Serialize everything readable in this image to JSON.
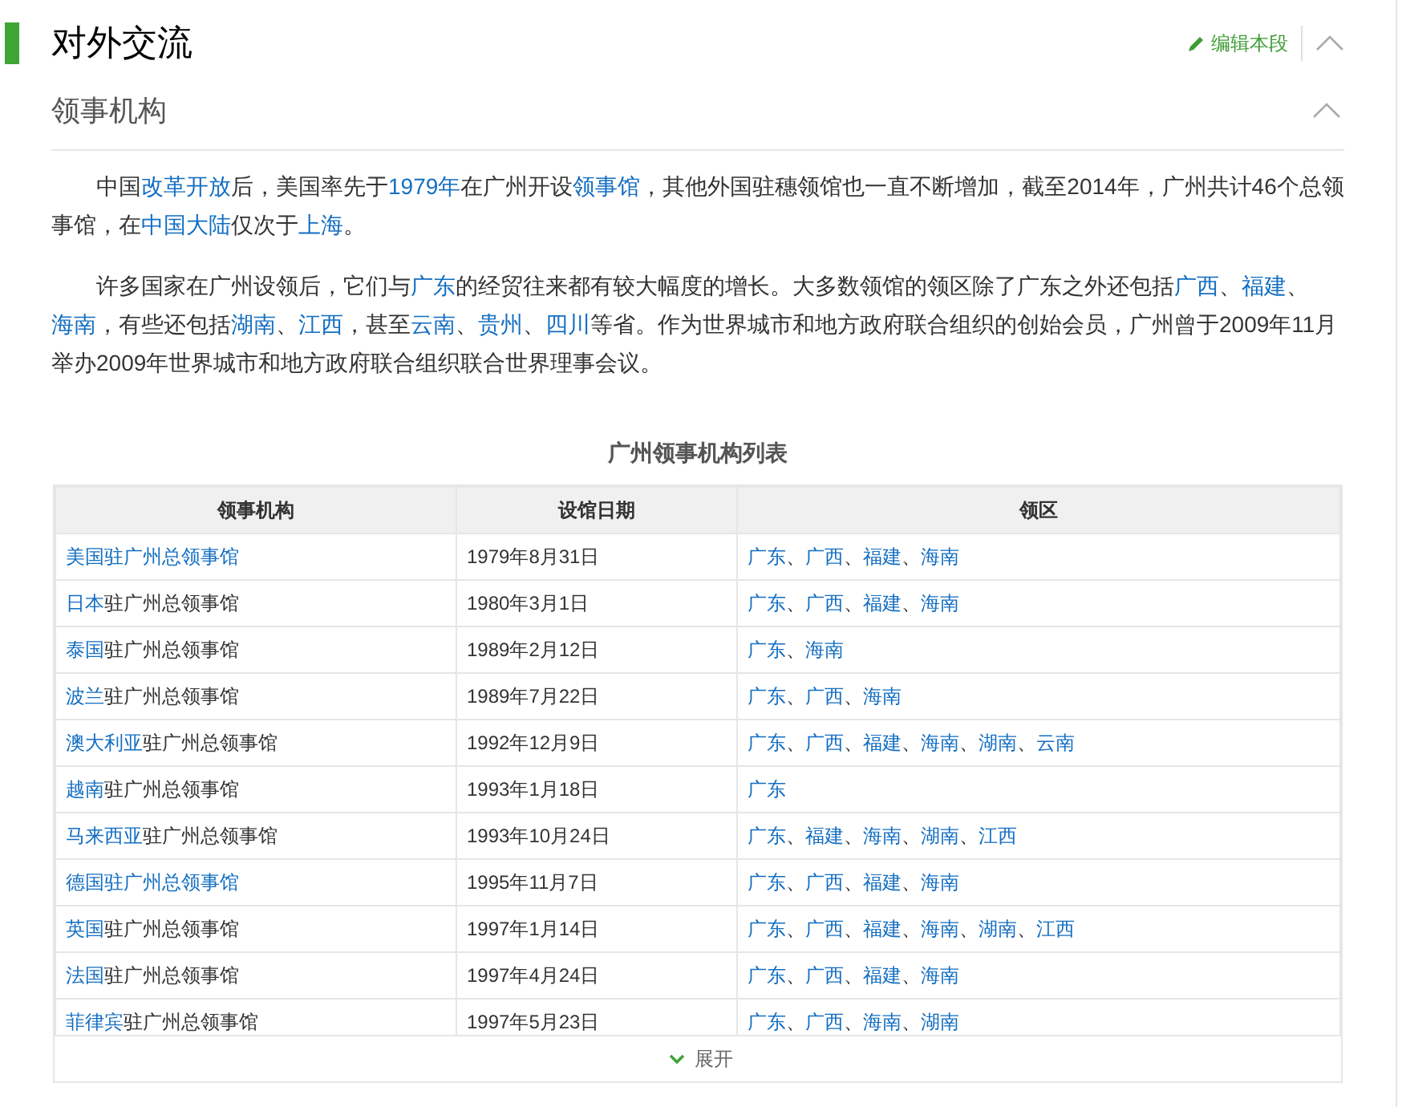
{
  "section": {
    "title": "对外交流",
    "edit_label": "编辑本段"
  },
  "subsection": {
    "title": "领事机构"
  },
  "paragraphs": [
    [
      {
        "text": "中国",
        "kind": "text"
      },
      {
        "text": "改革开放",
        "kind": "link"
      },
      {
        "text": "后，美国率先于",
        "kind": "text"
      },
      {
        "text": "1979年",
        "kind": "link"
      },
      {
        "text": "在广州开设",
        "kind": "text"
      },
      {
        "text": "领事馆",
        "kind": "link"
      },
      {
        "text": "，其他外国驻穗领馆也一直不断增加，截至2014年，广州共计46个总领事馆，在",
        "kind": "text"
      },
      {
        "text": "中国大陆",
        "kind": "link"
      },
      {
        "text": "仅次于",
        "kind": "text"
      },
      {
        "text": "上海",
        "kind": "link"
      },
      {
        "text": "。",
        "kind": "text"
      }
    ],
    [
      {
        "text": "许多国家在广州设领后，它们与",
        "kind": "text"
      },
      {
        "text": "广东",
        "kind": "link"
      },
      {
        "text": "的经贸往来都有较大幅度的增长。大多数领馆的领区除了广东之外还包括",
        "kind": "text"
      },
      {
        "text": "广西",
        "kind": "link"
      },
      {
        "text": "、",
        "kind": "text"
      },
      {
        "text": "福建",
        "kind": "link"
      },
      {
        "text": "、",
        "kind": "text"
      },
      {
        "text": "海南",
        "kind": "link"
      },
      {
        "text": "，有些还包括",
        "kind": "text"
      },
      {
        "text": "湖南",
        "kind": "link"
      },
      {
        "text": "、",
        "kind": "text"
      },
      {
        "text": "江西",
        "kind": "link"
      },
      {
        "text": "，甚至",
        "kind": "text"
      },
      {
        "text": "云南",
        "kind": "link"
      },
      {
        "text": "、",
        "kind": "text"
      },
      {
        "text": "贵州",
        "kind": "link"
      },
      {
        "text": "、",
        "kind": "text"
      },
      {
        "text": "四川",
        "kind": "link"
      },
      {
        "text": "等省。作为世界城市和地方政府联合组织的创始会员，广州曾于2009年11月举办2009年世界城市和地方政府联合组织联合世界理事会议。",
        "kind": "text"
      }
    ]
  ],
  "table": {
    "caption": "广州领事机构列表",
    "columns": [
      "领事机构",
      "设馆日期",
      "领区"
    ],
    "separator": "、",
    "rows": [
      {
        "name": [
          {
            "text": "美国驻广州总领事馆",
            "kind": "link"
          }
        ],
        "date": "1979年8月31日",
        "regions": [
          "广东",
          "广西",
          "福建",
          "海南"
        ]
      },
      {
        "name": [
          {
            "text": "日本",
            "kind": "link"
          },
          {
            "text": "驻广州总领事馆",
            "kind": "text"
          }
        ],
        "date": "1980年3月1日",
        "regions": [
          "广东",
          "广西",
          "福建",
          "海南"
        ]
      },
      {
        "name": [
          {
            "text": "泰国",
            "kind": "link"
          },
          {
            "text": "驻广州总领事馆",
            "kind": "text"
          }
        ],
        "date": "1989年2月12日",
        "regions": [
          "广东",
          "海南"
        ]
      },
      {
        "name": [
          {
            "text": "波兰",
            "kind": "link"
          },
          {
            "text": "驻广州总领事馆",
            "kind": "text"
          }
        ],
        "date": "1989年7月22日",
        "regions": [
          "广东",
          "广西",
          "海南"
        ]
      },
      {
        "name": [
          {
            "text": "澳大利亚",
            "kind": "link"
          },
          {
            "text": "驻广州总领事馆",
            "kind": "text"
          }
        ],
        "date": "1992年12月9日",
        "regions": [
          "广东",
          "广西",
          "福建",
          "海南",
          "湖南",
          "云南"
        ]
      },
      {
        "name": [
          {
            "text": "越南",
            "kind": "link"
          },
          {
            "text": "驻广州总领事馆",
            "kind": "text"
          }
        ],
        "date": "1993年1月18日",
        "regions": [
          "广东"
        ]
      },
      {
        "name": [
          {
            "text": "马来西亚",
            "kind": "link"
          },
          {
            "text": "驻广州总领事馆",
            "kind": "text"
          }
        ],
        "date": "1993年10月24日",
        "regions": [
          "广东",
          "福建",
          "海南",
          "湖南",
          "江西"
        ]
      },
      {
        "name": [
          {
            "text": "德国驻广州总领事馆",
            "kind": "link"
          }
        ],
        "date": "1995年11月7日",
        "regions": [
          "广东",
          "广西",
          "福建",
          "海南"
        ]
      },
      {
        "name": [
          {
            "text": "英国",
            "kind": "link"
          },
          {
            "text": "驻广州总领事馆",
            "kind": "text"
          }
        ],
        "date": "1997年1月14日",
        "regions": [
          "广东",
          "广西",
          "福建",
          "海南",
          "湖南",
          "江西"
        ]
      },
      {
        "name": [
          {
            "text": "法国",
            "kind": "link"
          },
          {
            "text": "驻广州总领事馆",
            "kind": "text"
          }
        ],
        "date": "1997年4月24日",
        "regions": [
          "广东",
          "广西",
          "福建",
          "海南"
        ]
      },
      {
        "name": [
          {
            "text": "菲律宾",
            "kind": "link"
          },
          {
            "text": "驻广州总领事馆",
            "kind": "text"
          }
        ],
        "date": "1997年5月23日",
        "regions": [
          "广东",
          "广西",
          "海南",
          "湖南"
        ]
      }
    ],
    "expand_label": "展开"
  }
}
